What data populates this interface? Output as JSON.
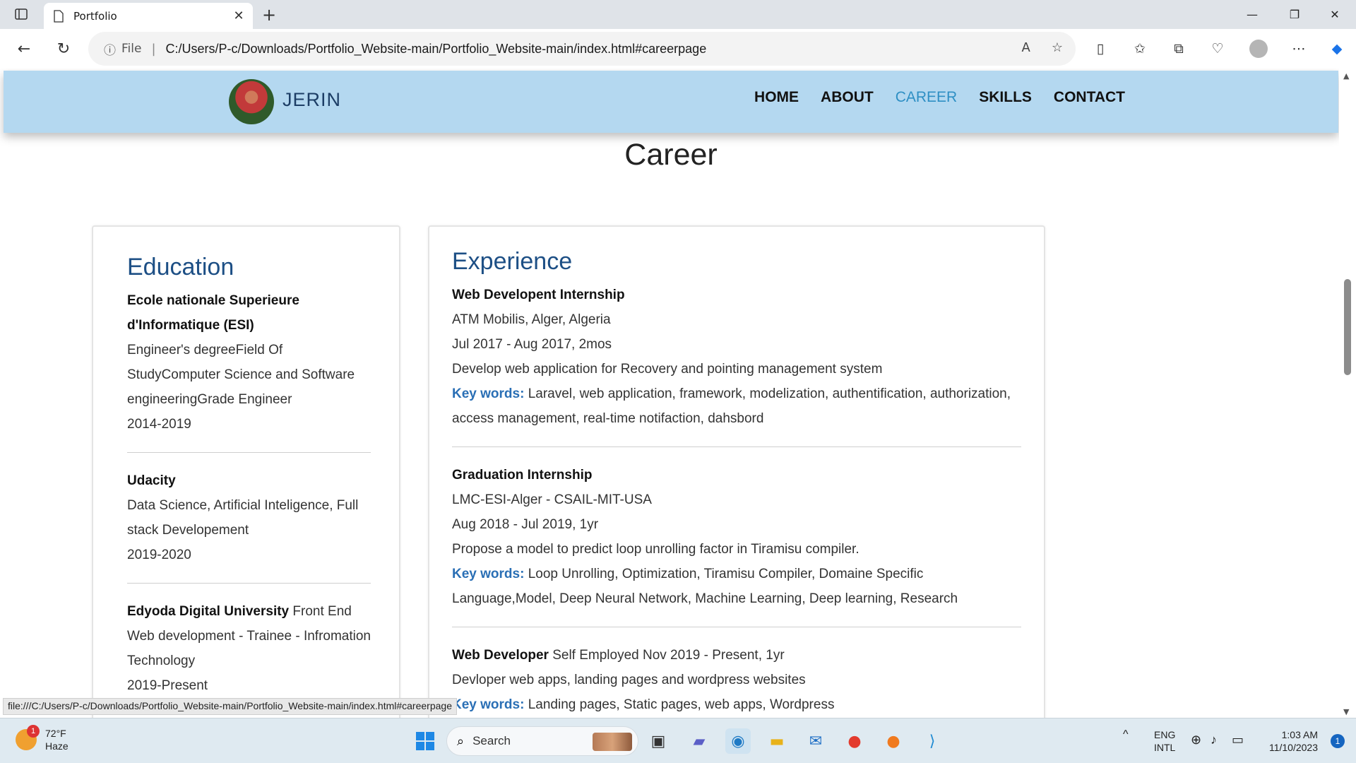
{
  "browser": {
    "tab_title": "Portfolio",
    "address_prefix": "File",
    "url": "C:/Users/P-c/Downloads/Portfolio_Website-main/Portfolio_Website-main/index.html#careerpage",
    "status_url": "file:///C:/Users/P-c/Downloads/Portfolio_Website-main/Portfolio_Website-main/index.html#careerpage"
  },
  "site": {
    "logo_text": "JERIN",
    "nav": [
      "HOME",
      "ABOUT",
      "CAREER",
      "SKILLS",
      "CONTACT"
    ],
    "active_nav": "CAREER",
    "active_color": "#2e8fc4",
    "header_bg": "#b4d8f0"
  },
  "career": {
    "heading": "Career",
    "education": {
      "title": "Education",
      "entries": [
        {
          "name": "Ecole nationale Superieure d'Informatique (ESI)",
          "detail": "Engineer's degreeField Of StudyComputer Science and Software engineeringGrade Engineer",
          "years": "2014-2019"
        },
        {
          "name": "Udacity",
          "detail": "Data Science, Artificial Inteligence, Full stack Developement",
          "years": "2019-2020"
        },
        {
          "name": "Edyoda Digital University",
          "detail": "Front End Web development - Trainee - Infromation Technology",
          "years": "2019-Present"
        }
      ]
    },
    "experience": {
      "title": "Experience",
      "keywords_label": "Key words:",
      "entries": [
        {
          "role": "Web Developent Internship",
          "company": "ATM Mobilis, Alger, Algeria",
          "period": "Jul 2017 - Aug 2017, 2mos",
          "description": "Develop web application for Recovery and pointing management system",
          "keywords": "Laravel, web application, framework, modelization, authentification, authorization, access management, real-time notifaction, dahsbord"
        },
        {
          "role": "Graduation Internship",
          "company": "LMC-ESI-Alger - CSAIL-MIT-USA",
          "period": "Aug 2018 - Jul 2019, 1yr",
          "description": "Propose a model to predict loop unrolling factor in Tiramisu compiler.",
          "keywords": "Loop Unrolling, Optimization, Tiramisu Compiler, Domaine Specific Language,Model, Deep Neural Network, Machine Learning, Deep learning, Research"
        },
        {
          "role": "Web Developer",
          "role_suffix": "Self Employed Nov 2019 - Present, 1yr",
          "description": "Devloper web apps, landing pages and wordpress websites",
          "keywords": "Landing pages, Static pages, web apps, Wordpress"
        }
      ]
    }
  },
  "taskbar": {
    "weather_temp": "72°F",
    "weather_desc": "Haze",
    "weather_badge": "1",
    "search_label": "Search",
    "lang_top": "ENG",
    "lang_bottom": "INTL",
    "time": "1:03 AM",
    "date": "11/10/2023",
    "notif_count": "1"
  }
}
